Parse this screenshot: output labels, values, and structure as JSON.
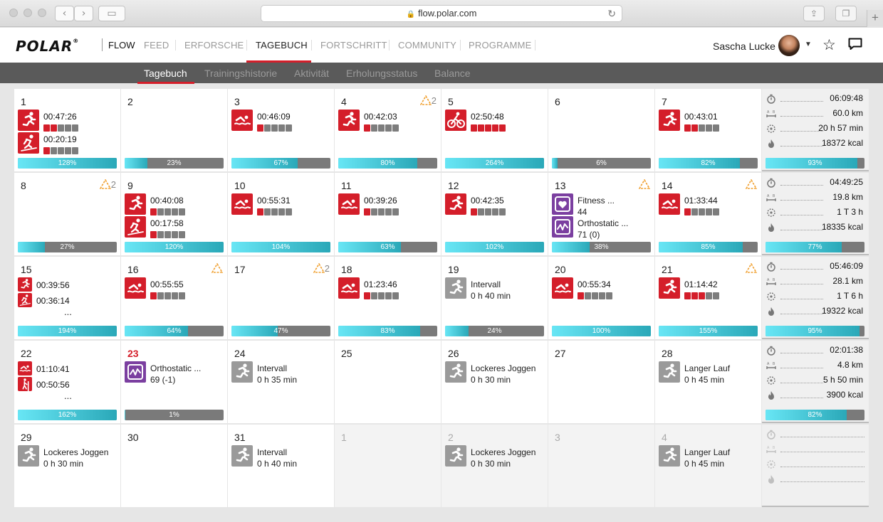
{
  "browser": {
    "url": "flow.polar.com"
  },
  "brand": {
    "logo": "POLAR",
    "reg": "®",
    "product": "FLOW"
  },
  "nav": {
    "items": [
      "FEED",
      "ERFORSCHE",
      "TAGEBUCH",
      "FORTSCHRITT",
      "COMMUNITY",
      "PROGRAMME"
    ],
    "active_index": 2
  },
  "user": {
    "name": "Sascha Lucke"
  },
  "subnav": {
    "items": [
      "Tagebuch",
      "Trainingshistorie",
      "Aktivität",
      "Erholungsstatus",
      "Balance"
    ],
    "active_index": 0
  },
  "colors": {
    "accent": "#d41e2a",
    "progress": "#68e6f5",
    "target": "#f0a030",
    "test": "#7b3fa0"
  },
  "weeks": [
    {
      "days": [
        {
          "num": "1",
          "acts": [
            {
              "icon": "run-icon",
              "time": "00:47:26",
              "zones": 2
            },
            {
              "icon": "ski-icon",
              "time": "00:20:19",
              "zones": 1
            }
          ],
          "progress": 128,
          "label": "128%"
        },
        {
          "num": "2",
          "acts": [],
          "progress": 23,
          "label": "23%"
        },
        {
          "num": "3",
          "acts": [
            {
              "icon": "swim-icon",
              "time": "00:46:09",
              "zones": 1
            }
          ],
          "progress": 67,
          "label": "67%"
        },
        {
          "num": "4",
          "targets": "2",
          "acts": [
            {
              "icon": "run-icon",
              "time": "00:42:03",
              "zones": 1
            }
          ],
          "progress": 80,
          "label": "80%"
        },
        {
          "num": "5",
          "acts": [
            {
              "icon": "bike-icon",
              "time": "02:50:48",
              "zones": 5
            }
          ],
          "progress": 264,
          "label": "264%"
        },
        {
          "num": "6",
          "acts": [],
          "progress": 6,
          "label": "6%"
        },
        {
          "num": "7",
          "acts": [
            {
              "icon": "run-icon",
              "time": "00:43:01",
              "zones": 2
            }
          ],
          "progress": 82,
          "label": "82%"
        }
      ],
      "summary": {
        "time": "06:09:48",
        "distance": "60.0 km",
        "recovery": "20 h 57 min",
        "calories": "18372 kcal",
        "progress": 93,
        "label": "93%"
      }
    },
    {
      "days": [
        {
          "num": "8",
          "targets": "2",
          "acts": [],
          "progress": 27,
          "label": "27%"
        },
        {
          "num": "9",
          "acts": [
            {
              "icon": "run-icon",
              "time": "00:40:08",
              "zones": 1
            },
            {
              "icon": "ski-icon",
              "time": "00:17:58",
              "zones": 1
            }
          ],
          "progress": 120,
          "label": "120%"
        },
        {
          "num": "10",
          "acts": [
            {
              "icon": "swim-icon",
              "time": "00:55:31",
              "zones": 1
            }
          ],
          "progress": 104,
          "label": "104%"
        },
        {
          "num": "11",
          "acts": [
            {
              "icon": "swim-icon",
              "time": "00:39:26",
              "zones": 1
            }
          ],
          "progress": 63,
          "label": "63%"
        },
        {
          "num": "12",
          "acts": [
            {
              "icon": "run-icon",
              "time": "00:42:35",
              "zones": 1
            }
          ],
          "progress": 102,
          "label": "102%"
        },
        {
          "num": "13",
          "targets": "",
          "acts": [
            {
              "icon": "fitness-test-icon",
              "name": "Fitness ...",
              "sub": "44"
            },
            {
              "icon": "orthostatic-test-icon",
              "name": "Orthostatic ...",
              "sub": "71 (0)"
            }
          ],
          "progress": 38,
          "label": "38%"
        },
        {
          "num": "14",
          "targets": "",
          "acts": [
            {
              "icon": "swim-icon",
              "time": "01:33:44",
              "zones": 1
            }
          ],
          "progress": 85,
          "label": "85%"
        }
      ],
      "summary": {
        "time": "04:49:25",
        "distance": "19.8 km",
        "recovery": "1 T 3 h",
        "calories": "18335 kcal",
        "progress": 77,
        "label": "77%"
      }
    },
    {
      "days": [
        {
          "num": "15",
          "acts": [
            {
              "icon": "run-icon",
              "time": "00:39:56",
              "small": true
            },
            {
              "icon": "ski-icon",
              "time": "00:36:14",
              "small": true
            }
          ],
          "more": "...",
          "progress": 194,
          "label": "194%"
        },
        {
          "num": "16",
          "targets": "",
          "acts": [
            {
              "icon": "swim-icon",
              "time": "00:55:55",
              "zones": 1
            }
          ],
          "progress": 64,
          "label": "64%"
        },
        {
          "num": "17",
          "targets": "2",
          "acts": [],
          "progress": 47,
          "label": "47%"
        },
        {
          "num": "18",
          "acts": [
            {
              "icon": "swim-icon",
              "time": "01:23:46",
              "zones": 1
            }
          ],
          "progress": 83,
          "label": "83%"
        },
        {
          "num": "19",
          "acts": [
            {
              "icon": "run-icon",
              "gray": true,
              "name": "Intervall",
              "sub": "0 h 40 min"
            }
          ],
          "progress": 24,
          "label": "24%"
        },
        {
          "num": "20",
          "acts": [
            {
              "icon": "swim-icon",
              "time": "00:55:34",
              "zones": 1
            }
          ],
          "progress": 100,
          "label": "100%"
        },
        {
          "num": "21",
          "targets": "",
          "acts": [
            {
              "icon": "run-icon",
              "time": "01:14:42",
              "zones": 3
            }
          ],
          "progress": 155,
          "label": "155%"
        }
      ],
      "summary": {
        "time": "05:46:09",
        "distance": "28.1 km",
        "recovery": "1 T 6 h",
        "calories": "19322 kcal",
        "progress": 95,
        "label": "95%"
      }
    },
    {
      "days": [
        {
          "num": "22",
          "acts": [
            {
              "icon": "swim-icon",
              "time": "01:10:41",
              "small": true
            },
            {
              "icon": "hike-icon",
              "time": "00:50:56",
              "small": true
            }
          ],
          "more": "...",
          "progress": 162,
          "label": "162%"
        },
        {
          "num": "23",
          "today": true,
          "acts": [
            {
              "icon": "orthostatic-test-icon",
              "name": "Orthostatic ...",
              "sub": "69 (-1)"
            }
          ],
          "progress": 1,
          "label": "1%"
        },
        {
          "num": "24",
          "acts": [
            {
              "icon": "run-icon",
              "gray": true,
              "name": "Intervall",
              "sub": "0 h 35 min"
            }
          ]
        },
        {
          "num": "25",
          "acts": []
        },
        {
          "num": "26",
          "acts": [
            {
              "icon": "run-icon",
              "gray": true,
              "name": "Lockeres Joggen",
              "sub": "0 h 30 min"
            }
          ]
        },
        {
          "num": "27",
          "acts": []
        },
        {
          "num": "28",
          "acts": [
            {
              "icon": "run-icon",
              "gray": true,
              "name": "Langer Lauf",
              "sub": "0 h 45 min"
            }
          ]
        }
      ],
      "summary": {
        "time": "02:01:38",
        "distance": "4.8 km",
        "recovery": "5 h 50 min",
        "calories": "3900 kcal",
        "progress": 82,
        "label": "82%"
      }
    },
    {
      "days": [
        {
          "num": "29",
          "acts": [
            {
              "icon": "run-icon",
              "gray": true,
              "name": "Lockeres Joggen",
              "sub": "0 h 30 min"
            }
          ]
        },
        {
          "num": "30",
          "acts": []
        },
        {
          "num": "31",
          "acts": [
            {
              "icon": "run-icon",
              "gray": true,
              "name": "Intervall",
              "sub": "0 h 40 min"
            }
          ]
        },
        {
          "num": "1",
          "dim": true,
          "acts": []
        },
        {
          "num": "2",
          "dim": true,
          "acts": [
            {
              "icon": "run-icon",
              "gray": true,
              "name": "Lockeres Joggen",
              "sub": "0 h 30 min"
            }
          ]
        },
        {
          "num": "3",
          "dim": true,
          "acts": []
        },
        {
          "num": "4",
          "dim": true,
          "acts": [
            {
              "icon": "run-icon",
              "gray": true,
              "name": "Langer Lauf",
              "sub": "0 h 45 min"
            }
          ]
        }
      ],
      "summary": {
        "dim": true
      }
    }
  ]
}
